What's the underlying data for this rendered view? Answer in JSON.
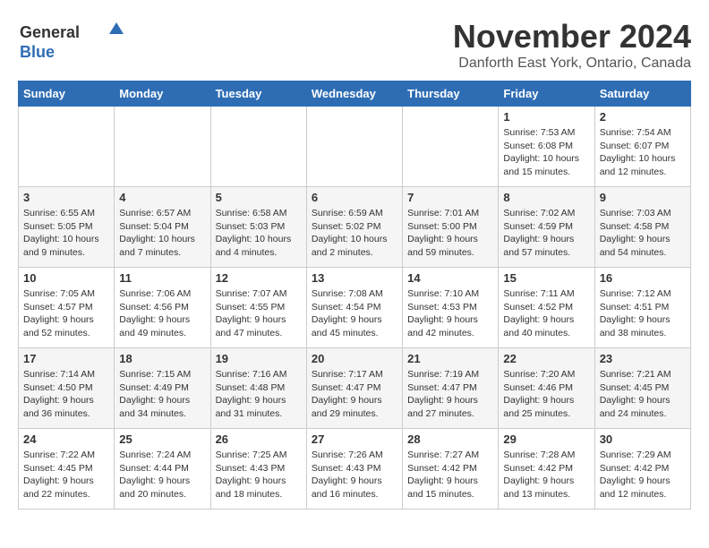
{
  "title": "November 2024",
  "subtitle": "Danforth East York, Ontario, Canada",
  "logo": {
    "general": "General",
    "blue": "Blue"
  },
  "weekdays": [
    "Sunday",
    "Monday",
    "Tuesday",
    "Wednesday",
    "Thursday",
    "Friday",
    "Saturday"
  ],
  "weeks": [
    [
      {
        "day": "",
        "info": ""
      },
      {
        "day": "",
        "info": ""
      },
      {
        "day": "",
        "info": ""
      },
      {
        "day": "",
        "info": ""
      },
      {
        "day": "",
        "info": ""
      },
      {
        "day": "1",
        "info": "Sunrise: 7:53 AM\nSunset: 6:08 PM\nDaylight: 10 hours and 15 minutes."
      },
      {
        "day": "2",
        "info": "Sunrise: 7:54 AM\nSunset: 6:07 PM\nDaylight: 10 hours and 12 minutes."
      }
    ],
    [
      {
        "day": "3",
        "info": "Sunrise: 6:55 AM\nSunset: 5:05 PM\nDaylight: 10 hours and 9 minutes."
      },
      {
        "day": "4",
        "info": "Sunrise: 6:57 AM\nSunset: 5:04 PM\nDaylight: 10 hours and 7 minutes."
      },
      {
        "day": "5",
        "info": "Sunrise: 6:58 AM\nSunset: 5:03 PM\nDaylight: 10 hours and 4 minutes."
      },
      {
        "day": "6",
        "info": "Sunrise: 6:59 AM\nSunset: 5:02 PM\nDaylight: 10 hours and 2 minutes."
      },
      {
        "day": "7",
        "info": "Sunrise: 7:01 AM\nSunset: 5:00 PM\nDaylight: 9 hours and 59 minutes."
      },
      {
        "day": "8",
        "info": "Sunrise: 7:02 AM\nSunset: 4:59 PM\nDaylight: 9 hours and 57 minutes."
      },
      {
        "day": "9",
        "info": "Sunrise: 7:03 AM\nSunset: 4:58 PM\nDaylight: 9 hours and 54 minutes."
      }
    ],
    [
      {
        "day": "10",
        "info": "Sunrise: 7:05 AM\nSunset: 4:57 PM\nDaylight: 9 hours and 52 minutes."
      },
      {
        "day": "11",
        "info": "Sunrise: 7:06 AM\nSunset: 4:56 PM\nDaylight: 9 hours and 49 minutes."
      },
      {
        "day": "12",
        "info": "Sunrise: 7:07 AM\nSunset: 4:55 PM\nDaylight: 9 hours and 47 minutes."
      },
      {
        "day": "13",
        "info": "Sunrise: 7:08 AM\nSunset: 4:54 PM\nDaylight: 9 hours and 45 minutes."
      },
      {
        "day": "14",
        "info": "Sunrise: 7:10 AM\nSunset: 4:53 PM\nDaylight: 9 hours and 42 minutes."
      },
      {
        "day": "15",
        "info": "Sunrise: 7:11 AM\nSunset: 4:52 PM\nDaylight: 9 hours and 40 minutes."
      },
      {
        "day": "16",
        "info": "Sunrise: 7:12 AM\nSunset: 4:51 PM\nDaylight: 9 hours and 38 minutes."
      }
    ],
    [
      {
        "day": "17",
        "info": "Sunrise: 7:14 AM\nSunset: 4:50 PM\nDaylight: 9 hours and 36 minutes."
      },
      {
        "day": "18",
        "info": "Sunrise: 7:15 AM\nSunset: 4:49 PM\nDaylight: 9 hours and 34 minutes."
      },
      {
        "day": "19",
        "info": "Sunrise: 7:16 AM\nSunset: 4:48 PM\nDaylight: 9 hours and 31 minutes."
      },
      {
        "day": "20",
        "info": "Sunrise: 7:17 AM\nSunset: 4:47 PM\nDaylight: 9 hours and 29 minutes."
      },
      {
        "day": "21",
        "info": "Sunrise: 7:19 AM\nSunset: 4:47 PM\nDaylight: 9 hours and 27 minutes."
      },
      {
        "day": "22",
        "info": "Sunrise: 7:20 AM\nSunset: 4:46 PM\nDaylight: 9 hours and 25 minutes."
      },
      {
        "day": "23",
        "info": "Sunrise: 7:21 AM\nSunset: 4:45 PM\nDaylight: 9 hours and 24 minutes."
      }
    ],
    [
      {
        "day": "24",
        "info": "Sunrise: 7:22 AM\nSunset: 4:45 PM\nDaylight: 9 hours and 22 minutes."
      },
      {
        "day": "25",
        "info": "Sunrise: 7:24 AM\nSunset: 4:44 PM\nDaylight: 9 hours and 20 minutes."
      },
      {
        "day": "26",
        "info": "Sunrise: 7:25 AM\nSunset: 4:43 PM\nDaylight: 9 hours and 18 minutes."
      },
      {
        "day": "27",
        "info": "Sunrise: 7:26 AM\nSunset: 4:43 PM\nDaylight: 9 hours and 16 minutes."
      },
      {
        "day": "28",
        "info": "Sunrise: 7:27 AM\nSunset: 4:42 PM\nDaylight: 9 hours and 15 minutes."
      },
      {
        "day": "29",
        "info": "Sunrise: 7:28 AM\nSunset: 4:42 PM\nDaylight: 9 hours and 13 minutes."
      },
      {
        "day": "30",
        "info": "Sunrise: 7:29 AM\nSunset: 4:42 PM\nDaylight: 9 hours and 12 minutes."
      }
    ]
  ]
}
